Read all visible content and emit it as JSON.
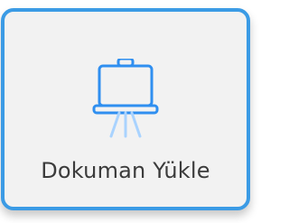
{
  "tile": {
    "label": "Dokuman Yükle",
    "icon": "presentation-board-icon"
  },
  "colors": {
    "accent": "#3b9be5",
    "icon": "#2f8ff0",
    "icon_light": "#a9d3ff",
    "background": "#f2f2f2",
    "text": "#3b3b3b"
  }
}
